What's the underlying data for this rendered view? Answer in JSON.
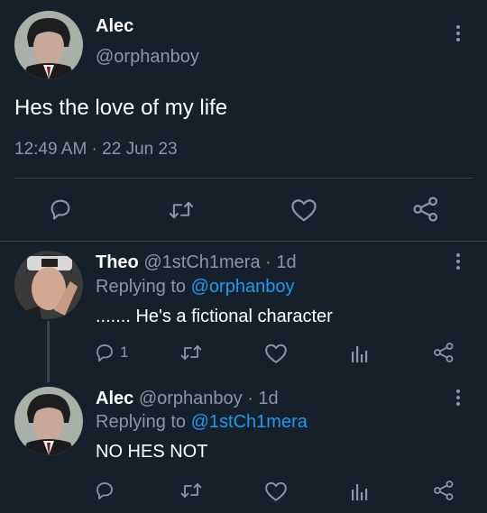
{
  "main_tweet": {
    "author_name": "Alec",
    "handle": "@orphanboy",
    "text": "Hes the love of my life",
    "timestamp": "12:49 AM · 22 Jun 23"
  },
  "replies": [
    {
      "author_name": "Theo",
      "handle_meta": "@1stCh1mera · 1d",
      "replying_prefix": "Replying to",
      "replying_to": "@orphanboy",
      "text": "....... He's a fictional character",
      "reply_count": "1"
    },
    {
      "author_name": "Alec",
      "handle_meta": "@orphanboy · 1d",
      "replying_prefix": "Replying to",
      "replying_to": "@1stCh1mera",
      "text": "NO HES NOT",
      "reply_count": ""
    }
  ],
  "icons": [
    "reply-icon",
    "retweet-icon",
    "like-icon",
    "share-icon",
    "analytics-icon",
    "more-icon"
  ],
  "colors": {
    "background": "#15202b",
    "secondary_text": "#8899a6",
    "link": "#1d9bf0",
    "divider": "#38444d"
  }
}
